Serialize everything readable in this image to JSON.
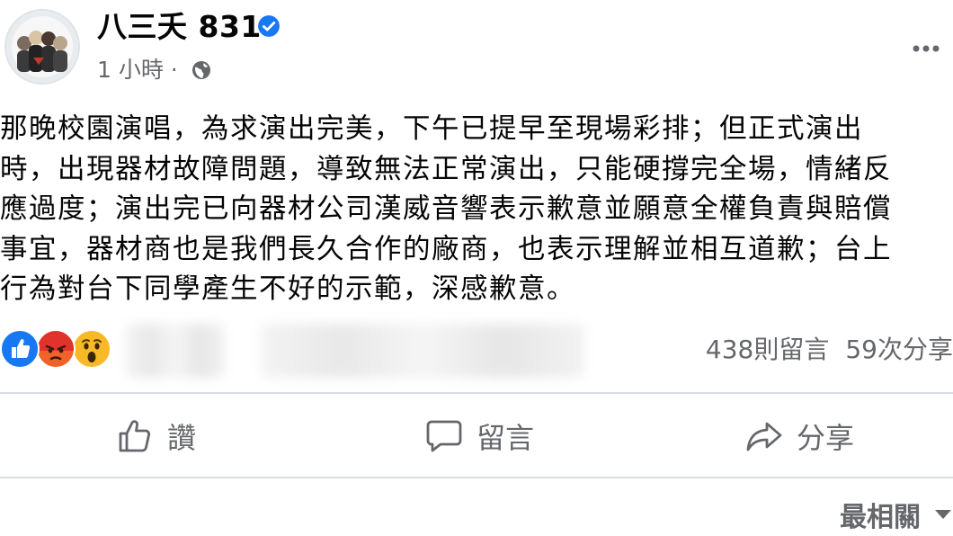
{
  "post": {
    "page_name": "八三夭 831",
    "time": "1 小時 ·",
    "text": "那晚校園演唱，為求演出完美，下午已提早至現場彩排；但正式演出\n時，出現器材故障問題，導致無法正常演出，只能硬撐完全場，情緒反\n應過度；演出完已向器材公司漢威音響表示歉意並願意全權負責與賠償\n事宜，器材商也是我們長久合作的廠商，也表示理解並相互道歉；台上\n行為對台下同學產生不好的示範，深感歉意。"
  },
  "stats": {
    "comments": "438則留言",
    "shares": "59次分享"
  },
  "actions": {
    "like": "讚",
    "comment": "留言",
    "share": "分享"
  },
  "sort": {
    "label": "最相關"
  },
  "icons": {
    "verified": "verified-badge-icon",
    "audience": "globe-icon",
    "more": "more-options-icon",
    "reactions": [
      "like-reaction-icon",
      "angry-reaction-icon",
      "wow-reaction-icon"
    ]
  },
  "colors": {
    "facebook_blue": "#1877f2",
    "secondary_text": "#65676b",
    "angry": "#f0622a",
    "wow": "#f7b928"
  }
}
